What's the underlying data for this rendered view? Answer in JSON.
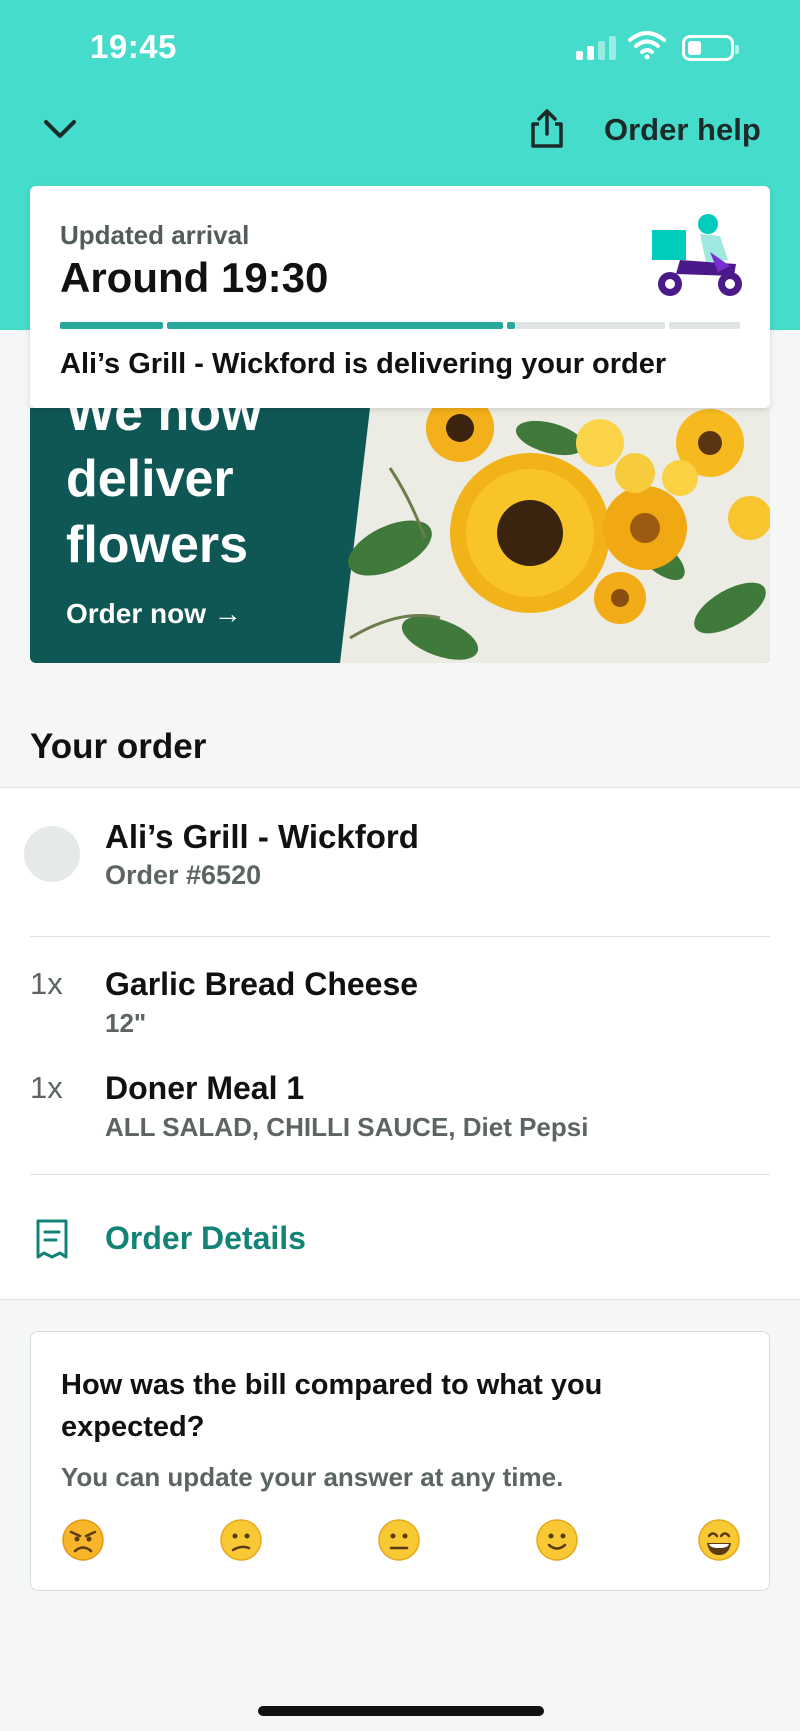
{
  "status_bar": {
    "time": "19:45"
  },
  "header": {
    "order_help": "Order help"
  },
  "arrival": {
    "label": "Updated arrival",
    "time": "Around 19:30",
    "delivering": "Ali’s Grill - Wickford is delivering your order"
  },
  "banner": {
    "headline_lines": [
      "We now",
      "deliver",
      "flowers"
    ],
    "cta": "Order now →"
  },
  "order": {
    "section_title": "Your order",
    "restaurant": "Ali’s Grill - Wickford",
    "order_number": "Order #6520",
    "items": [
      {
        "qty": "1x",
        "name": "Garlic Bread Cheese",
        "desc": "12\""
      },
      {
        "qty": "1x",
        "name": "Doner Meal 1",
        "desc": "ALL SALAD, CHILLI SAUCE, Diet Pepsi"
      }
    ],
    "details_link": "Order Details"
  },
  "feedback": {
    "question": "How was the bill compared to what you expected?",
    "subtext": "You can update your answer at any time.",
    "options": [
      "angry-face",
      "confused-face",
      "neutral-face",
      "slightly-smiling-face",
      "grinning-face"
    ]
  },
  "colors": {
    "header_teal": "#45dccb",
    "accent_teal": "#138378",
    "banner_green": "#0f5755"
  }
}
